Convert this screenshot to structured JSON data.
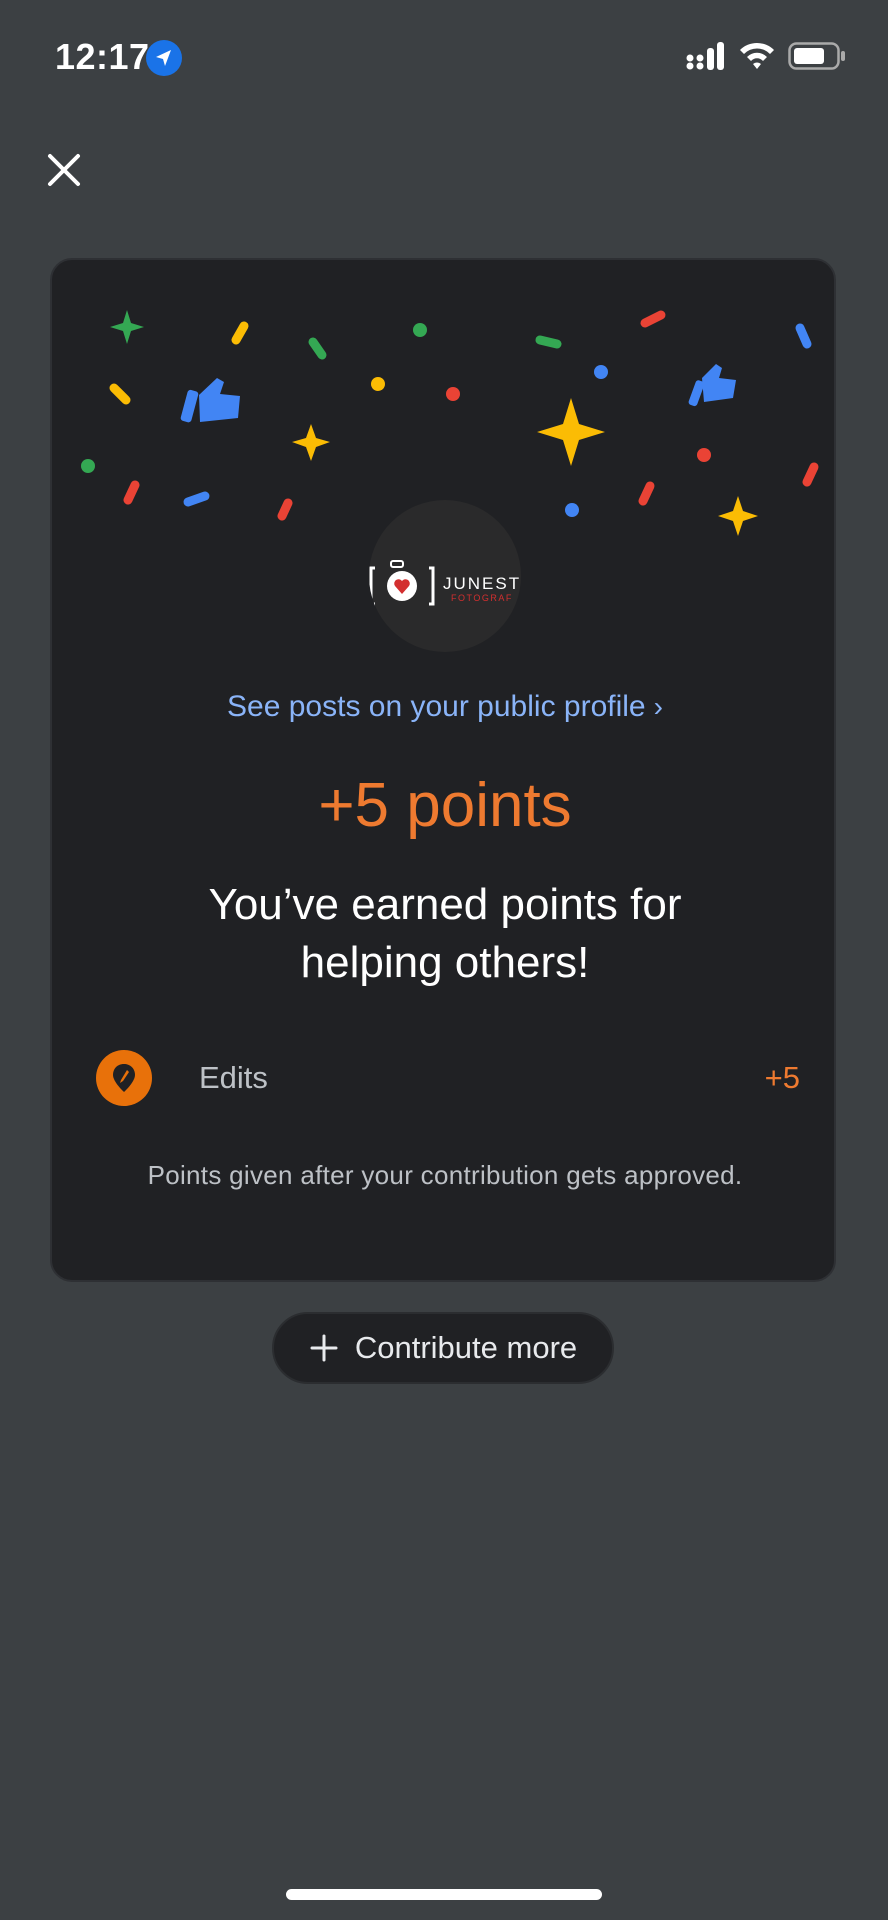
{
  "status_bar": {
    "time": "12:17",
    "icons": [
      "location-arrow-icon",
      "signal-icon",
      "wifi-icon",
      "battery-icon"
    ]
  },
  "header": {
    "close_icon": "close-icon"
  },
  "card": {
    "avatar_logo_text": "JUNEST",
    "avatar_logo_subtext": "FOTOGRAF",
    "profile_link_label": "See posts on your public profile",
    "points_title": "+5 points",
    "earned_message": "You’ve earned points for helping others!",
    "row": {
      "icon": "map-pin-edit-icon",
      "label": "Edits",
      "points": "+5"
    },
    "footnote": "Points given after your contribution gets approved."
  },
  "contribute_button": {
    "icon": "plus-icon",
    "label": "Contribute more"
  },
  "colors": {
    "background": "#3c4043",
    "card": "#202124",
    "accent_orange": "#ee7a30",
    "link_blue": "#8ab4f8"
  }
}
